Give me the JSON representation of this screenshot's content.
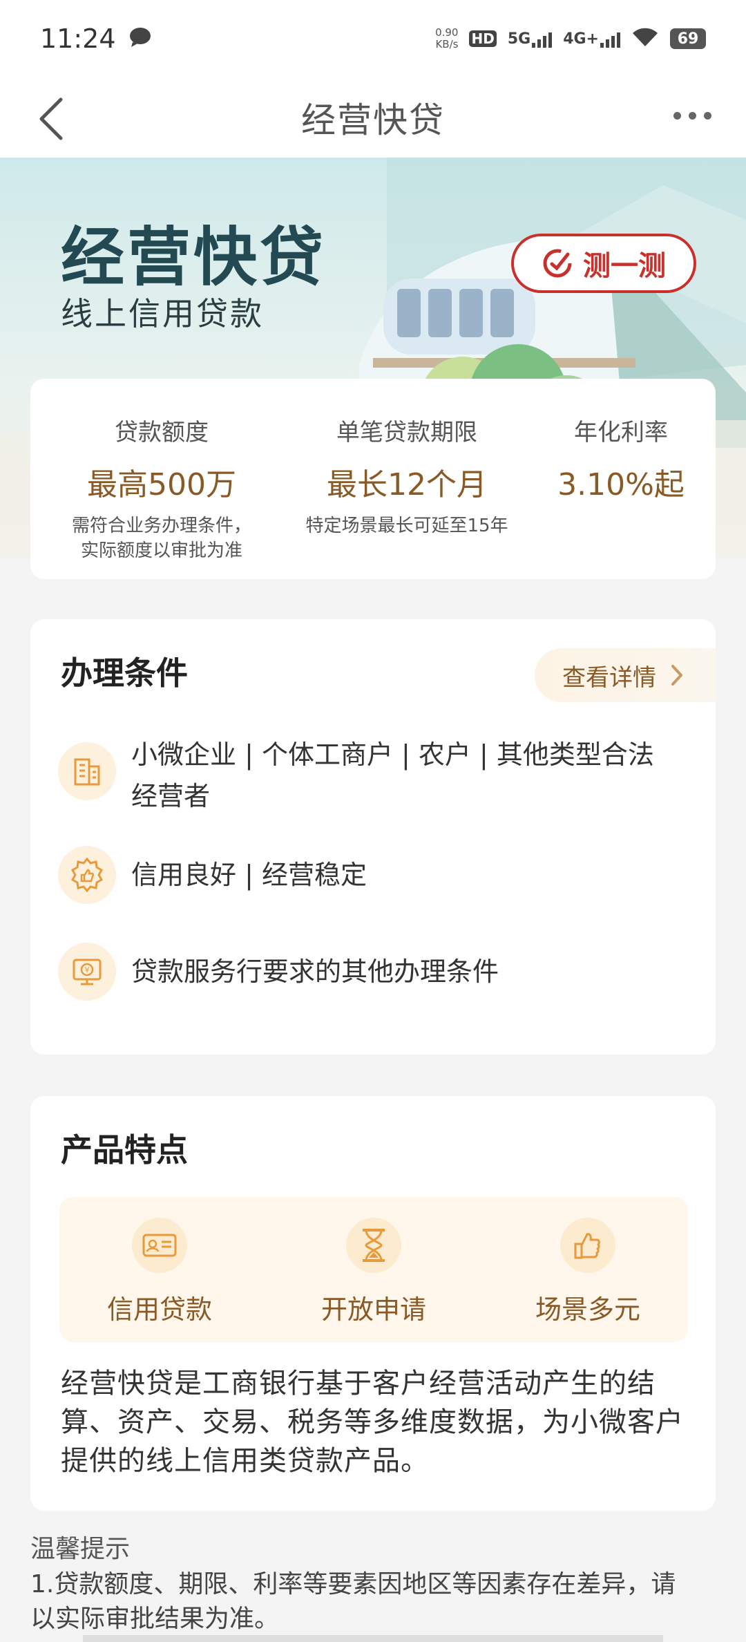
{
  "status_bar": {
    "time": "11:24",
    "net_speed_value": "0.90",
    "net_speed_unit": "KB/s",
    "hd_label": "HD",
    "signal_1": "5G",
    "signal_2": "4G+",
    "battery": "69"
  },
  "nav": {
    "title": "经营快贷"
  },
  "banner": {
    "title": "经营快贷",
    "subtitle": "线上信用贷款",
    "test_button": "测一测"
  },
  "info": {
    "columns": [
      {
        "label": "贷款额度",
        "value": "最高500万",
        "note_line1": "需符合业务办理条件，",
        "note_line2": "实际额度以审批为准"
      },
      {
        "label": "单笔贷款期限",
        "value": "最长12个月",
        "note_line1": "特定场景最长可延至15年",
        "note_line2": ""
      },
      {
        "label": "年化利率",
        "value": "3.10%起",
        "note_line1": "",
        "note_line2": ""
      }
    ]
  },
  "conditions": {
    "title": "办理条件",
    "detail_link": "查看详情",
    "items": [
      {
        "text": "小微企业 | 个体工商户 | 农户 | 其他类型合法经营者",
        "icon": "building-icon"
      },
      {
        "text": "信用良好 | 经营稳定",
        "icon": "thumbs-up-badge-icon"
      },
      {
        "text": "贷款服务行要求的其他办理条件",
        "icon": "monitor-yen-icon"
      }
    ]
  },
  "features": {
    "title": "产品特点",
    "items": [
      {
        "label": "信用贷款",
        "icon": "id-card-icon"
      },
      {
        "label": "开放申请",
        "icon": "hourglass-icon"
      },
      {
        "label": "场景多元",
        "icon": "thumbs-up-icon"
      }
    ],
    "description": "经营快贷是工商银行基于客户经营活动产生的结算、资产、交易、税务等多维度数据，为小微客户提供的线上信用类贷款产品。"
  },
  "tips": {
    "title": "温馨提示",
    "text": "1.贷款额度、期限、利率等要素因地区等因素存在差异，请以实际审批结果为准。"
  },
  "colors": {
    "accent_gold": "#8a5a26",
    "button_red": "#c9302c",
    "banner_teal": "#234a52"
  }
}
